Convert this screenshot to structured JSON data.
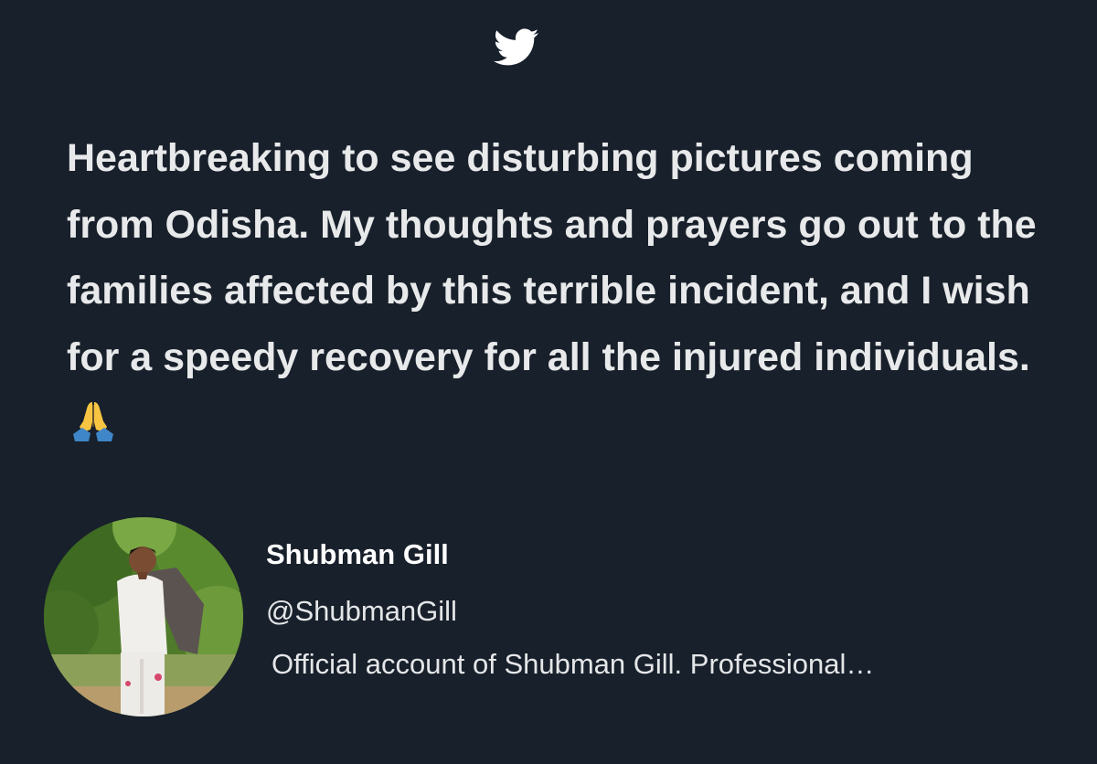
{
  "logo_icon": "twitter-bird-icon",
  "tweet": {
    "text": "Heartbreaking to see disturbing pictures coming from Odisha. My thoughts and prayers go out to the families affected by this terrible incident, and I wish for a speedy recovery for all the injured individuals.",
    "emoji_icon": "folded-hands-icon"
  },
  "author": {
    "name": "Shubman Gill",
    "handle": "@ShubmanGill",
    "bio": "Official account of Shubman Gill. Professional…",
    "avatar_icon": "profile-photo"
  },
  "colors": {
    "background": "#18202b",
    "text": "#e7e9ea",
    "accent": "#ffffff"
  }
}
